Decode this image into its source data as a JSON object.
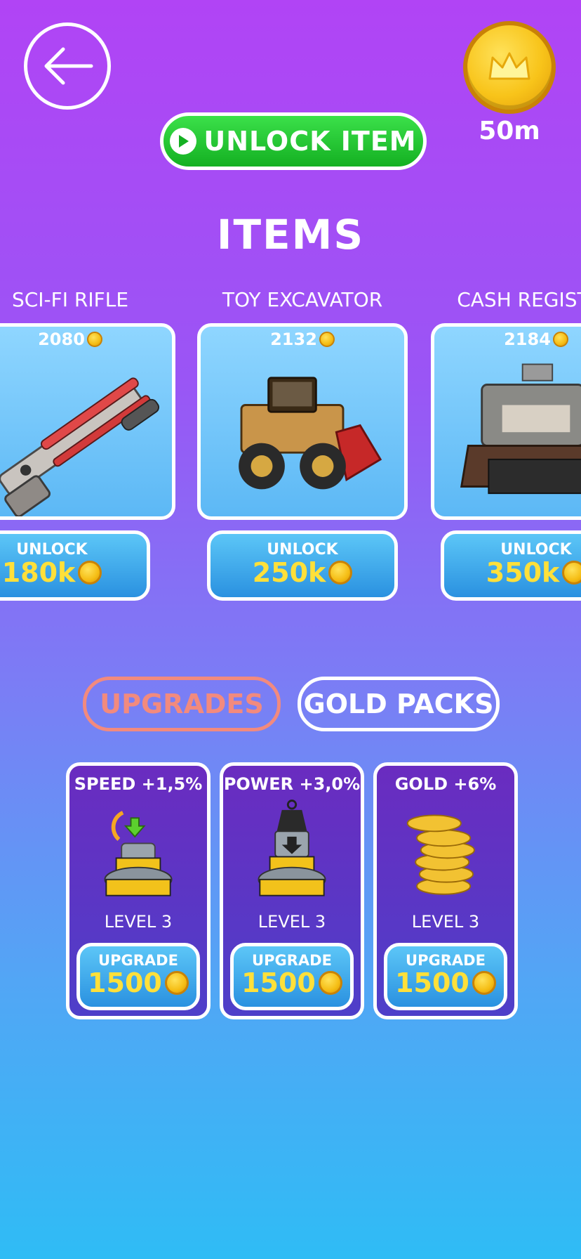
{
  "header": {
    "back_icon": "arrow-left-icon",
    "coin_icon": "crown-coin-icon",
    "coin_balance": "50m",
    "unlock_item_label": "UNLOCK ITEM"
  },
  "items_section": {
    "title": "ITEMS",
    "items": [
      {
        "name": "SCI-FI RIFLE",
        "price": "2080",
        "unlock_label": "UNLOCK",
        "unlock_cost": "180k"
      },
      {
        "name": "TOY EXCAVATOR",
        "price": "2132",
        "unlock_label": "UNLOCK",
        "unlock_cost": "250k"
      },
      {
        "name": "CASH REGISTER",
        "price": "2184",
        "unlock_label": "UNLOCK",
        "unlock_cost": "350k"
      }
    ]
  },
  "tabs": {
    "upgrades": "UPGRADES",
    "gold_packs": "GOLD PACKS",
    "active": "upgrades"
  },
  "upgrades": [
    {
      "title": "SPEED +1,5%",
      "level": "LEVEL 3",
      "button_label": "UPGRADE",
      "cost": "1500"
    },
    {
      "title": "POWER +3,0%",
      "level": "LEVEL 3",
      "button_label": "UPGRADE",
      "cost": "1500"
    },
    {
      "title": "GOLD +6%",
      "level": "LEVEL 3",
      "button_label": "UPGRADE",
      "cost": "1500"
    }
  ],
  "colors": {
    "accent_green": "#14b022",
    "tab_active": "#f28a7e",
    "price_yellow": "#ffe03a"
  }
}
